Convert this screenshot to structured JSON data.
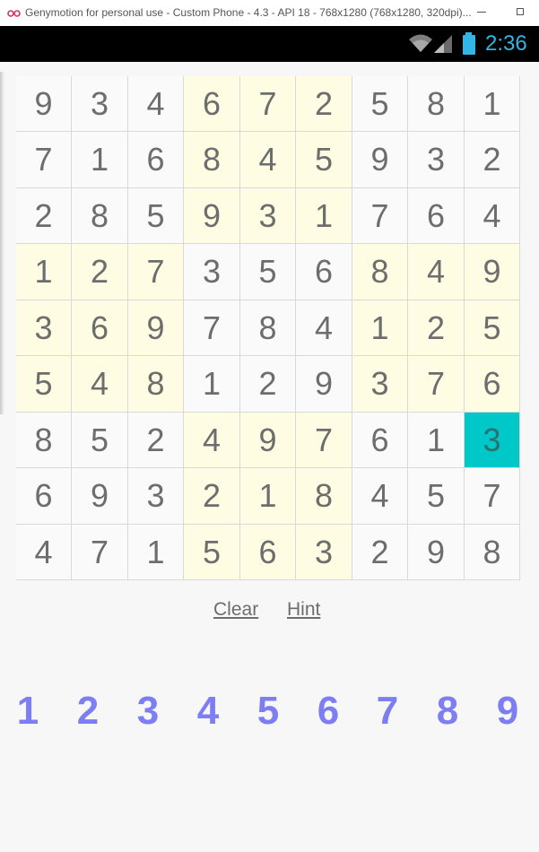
{
  "window": {
    "title": "Genymotion for personal use - Custom Phone - 4.3 - API 18 - 768x1280 (768x1280, 320dpi)..."
  },
  "statusbar": {
    "time": "2:36",
    "icons": [
      "wifi-icon",
      "signal-icon",
      "battery-icon"
    ]
  },
  "board": {
    "rows": [
      [
        "9",
        "3",
        "4",
        "6",
        "7",
        "2",
        "5",
        "8",
        "1"
      ],
      [
        "7",
        "1",
        "6",
        "8",
        "4",
        "5",
        "9",
        "3",
        "2"
      ],
      [
        "2",
        "8",
        "5",
        "9",
        "3",
        "1",
        "7",
        "6",
        "4"
      ],
      [
        "1",
        "2",
        "7",
        "3",
        "5",
        "6",
        "8",
        "4",
        "9"
      ],
      [
        "3",
        "6",
        "9",
        "7",
        "8",
        "4",
        "1",
        "2",
        "5"
      ],
      [
        "5",
        "4",
        "8",
        "1",
        "2",
        "9",
        "3",
        "7",
        "6"
      ],
      [
        "8",
        "5",
        "2",
        "4",
        "9",
        "7",
        "6",
        "1",
        "3"
      ],
      [
        "6",
        "9",
        "3",
        "2",
        "1",
        "8",
        "4",
        "5",
        "7"
      ],
      [
        "4",
        "7",
        "1",
        "5",
        "6",
        "3",
        "2",
        "9",
        "8"
      ]
    ],
    "selected_cell": {
      "row": 7,
      "col": 9
    }
  },
  "actions": {
    "clear_label": "Clear",
    "hint_label": "Hint"
  },
  "number_pad": [
    "1",
    "2",
    "3",
    "4",
    "5",
    "6",
    "7",
    "8",
    "9"
  ],
  "colors": {
    "cell_background": "#fafafa",
    "highlighted_cell_background": "#fefde3",
    "selected_cell_background": "#00c8c8",
    "number_pad_text": "#7d7ef2",
    "clock_text": "#33b5e5"
  }
}
